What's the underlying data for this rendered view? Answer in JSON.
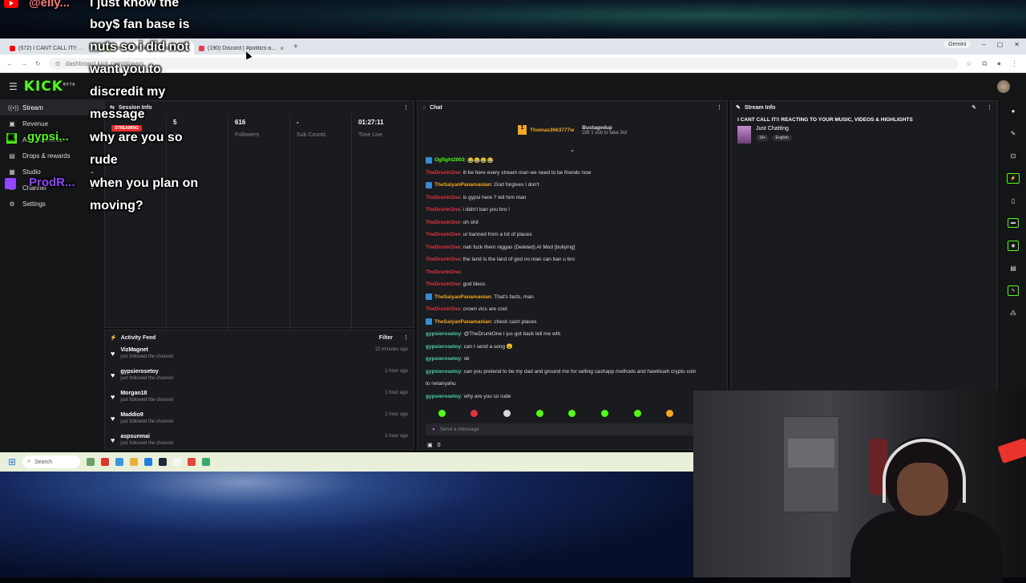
{
  "browser": {
    "tabs": [
      {
        "title": "(572) I CANT CALL IT!! REACTIN",
        "color": "#ff0000",
        "active": false
      },
      {
        "title": "Stream - Kick Dashboard",
        "color": "#53fc18",
        "active": true
      },
      {
        "title": "(190) Discord | #politics-and-n",
        "color": "#e04050",
        "active": false
      }
    ],
    "gemini_label": "Gemini",
    "url": "dashboard.kick.com/stream"
  },
  "sidebar": {
    "items": [
      {
        "label": "Stream",
        "icon": "broadcast-icon"
      },
      {
        "label": "Revenue",
        "icon": "revenue-icon"
      },
      {
        "label": "Achievements",
        "icon": "trophy-icon"
      },
      {
        "label": "Drops & rewards",
        "icon": "gift-icon"
      },
      {
        "label": "Studio",
        "icon": "studio-icon"
      },
      {
        "label": "Channel",
        "icon": "channel-icon"
      },
      {
        "label": "Settings",
        "icon": "gear-icon"
      }
    ]
  },
  "session": {
    "title": "Session Info",
    "status": "STREAMING",
    "stats": [
      {
        "value": "",
        "label": ""
      },
      {
        "value": "5",
        "label": "rs"
      },
      {
        "value": "616",
        "label": "Followers"
      },
      {
        "value": "-",
        "label": "Sub Counts"
      },
      {
        "value": "01:27:11",
        "label": "Time Live"
      }
    ]
  },
  "activity": {
    "title": "Activity Feed",
    "filter_label": "Filter",
    "rows": [
      {
        "name": "VizMagnet",
        "desc": "just followed the channel",
        "time": "22 minutes ago"
      },
      {
        "name": "gypsierosetoy",
        "desc": "just followed the channel",
        "time": "1 hour ago"
      },
      {
        "name": "Morgan18",
        "desc": "just followed the channel",
        "time": "1 hour ago"
      },
      {
        "name": "Maddio9",
        "desc": "just followed the channel",
        "time": "1 hour ago"
      },
      {
        "name": "aspsunmai",
        "desc": "just followed the channel",
        "time": "1 hour ago"
      }
    ]
  },
  "chat": {
    "title": "Chat",
    "pinned_user": "Thomas3663777w",
    "pinned_count": "1",
    "pinned_user2": "Bustagedup",
    "pinned_note": "Gift 1 sub to take 3rd",
    "messages": [
      {
        "user": "Ogfight2003",
        "text": ": 😂😂😂😂",
        "color": "#53fc18",
        "mod": true
      },
      {
        "user": "TheDrunkOne",
        "text": ": ill be here every stream man we need to be friends now",
        "color": "#e0333e",
        "mod": false
      },
      {
        "user": "TheSaiyanPanamanian",
        "text": ": God forgives I don't",
        "color": "#f6a723",
        "mod": true
      },
      {
        "user": "TheDrunkOne",
        "text": ": is gypsi here ? tell him man",
        "color": "#e0333e",
        "mod": false
      },
      {
        "user": "TheDrunkOne",
        "text": ": i didn't ban you bro !",
        "color": "#e0333e",
        "mod": false
      },
      {
        "user": "TheDrunkOne",
        "text": ": oh shit",
        "color": "#e0333e",
        "mod": false
      },
      {
        "user": "TheDrunkOne",
        "text": ": ur banned from a lot of places",
        "color": "#e0333e",
        "mod": false
      },
      {
        "user": "TheDrunkOne",
        "text": ": nah fuck them niggas (Deleted) AI Mod [bullying]",
        "color": "#e0333e",
        "mod": false
      },
      {
        "user": "TheDrunkOne",
        "text": ": the land is the land of god no man can ban u bro",
        "color": "#e0333e",
        "mod": false
      },
      {
        "user": "TheDrunkOne",
        "text": ":",
        "color": "#e0333e",
        "mod": false
      },
      {
        "user": "TheDrunkOne",
        "text": ": god bless",
        "color": "#e0333e",
        "mod": false
      },
      {
        "user": "TheSaiyanPanamanian",
        "text": ": That's facts, man",
        "color": "#f6a723",
        "mod": true
      },
      {
        "user": "TheDrunkOne",
        "text": ": crown vics are cool",
        "color": "#e0333e",
        "mod": false
      },
      {
        "user": "TheSaiyanPanamanian",
        "text": ": check cash places",
        "color": "#f6a723",
        "mod": true
      },
      {
        "user": "gypsierosetoy",
        "text": ": @TheDrunkOne I jus got back tell me wht",
        "color": "#4fd1a5",
        "mod": false
      },
      {
        "user": "gypsierosetoy",
        "text": ": can I send a song 😮",
        "color": "#4fd1a5",
        "mod": false
      },
      {
        "user": "gypsierosetoy",
        "text": ": ok",
        "color": "#4fd1a5",
        "mod": false
      },
      {
        "user": "gypsierosetoy",
        "text": ": can you pretend to be my dad and ground me for selling cashapp methods and hawktuah crypto coin",
        "color": "#4fd1a5",
        "mod": false
      },
      {
        "user": "",
        "text": "to netanyahu",
        "color": "#4fd1a5",
        "mod": false
      },
      {
        "user": "gypsierosetoy",
        "text": ": why are you so rude",
        "color": "#4fd1a5",
        "mod": false
      }
    ],
    "input_placeholder": "Send a message",
    "footer_count": "0",
    "emote_colors": [
      "#53fc18",
      "#e0333e",
      "#d8d8d8",
      "#53fc18",
      "#53fc18",
      "#53fc18",
      "#53fc18",
      "#f6a723",
      "#53fc18"
    ]
  },
  "stream_info": {
    "title": "Stream Info",
    "stream_title": "I CANT CALL IT!! REACTING TO YOUR MUSIC, VIDEOS & HIGHLIGHTS",
    "category": "Just Chatting",
    "tags": [
      "18+",
      "English"
    ]
  },
  "taskbar": {
    "search_placeholder": "Search"
  },
  "overlay": {
    "yt_user": "@elly...",
    "kick_user": "gypsi...",
    "twitch_user": "ProdR...",
    "lines": [
      "I just know the",
      "boy$ fan base is",
      "nuts so i did not",
      "want you to",
      "discredit my",
      "message",
      "why are you so",
      "rude",
      "when you plan on",
      "moving?"
    ]
  }
}
